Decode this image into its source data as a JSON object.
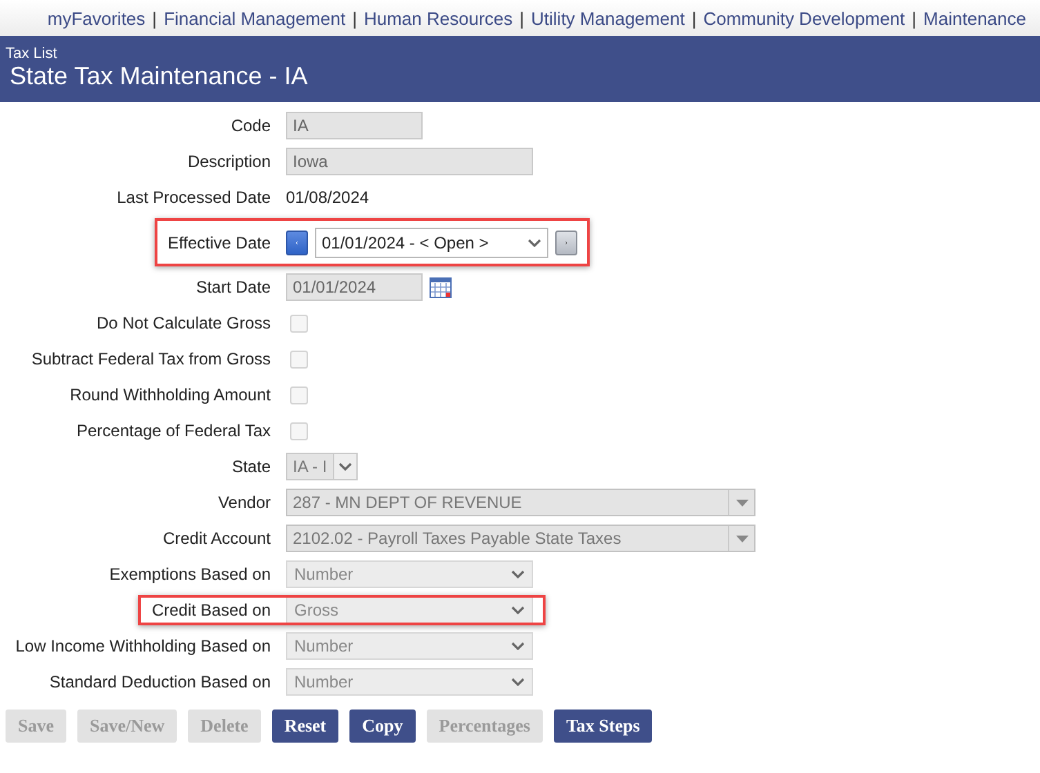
{
  "nav": {
    "separator": "|",
    "items": [
      "myFavorites",
      "Financial Management",
      "Human Resources",
      "Utility Management",
      "Community Development",
      "Maintenance"
    ]
  },
  "header": {
    "breadcrumb": "Tax List",
    "title": "State Tax Maintenance - IA"
  },
  "form": [
    {
      "label": "Code",
      "kind": "short-text",
      "value": "IA",
      "highlighted": false
    },
    {
      "label": "Description",
      "kind": "long-text",
      "value": "Iowa",
      "highlighted": false
    },
    {
      "label": "Last Processed Date",
      "kind": "static",
      "value": "01/08/2024",
      "highlighted": false
    },
    {
      "label": "Effective Date",
      "kind": "period",
      "value": "01/01/2024 - < Open >",
      "highlighted": true
    },
    {
      "label": "Start Date",
      "kind": "date",
      "value": "01/01/2024",
      "highlighted": false
    },
    {
      "label": "Do Not Calculate Gross",
      "kind": "checkbox",
      "checked": false,
      "highlighted": false
    },
    {
      "label": "Subtract Federal Tax from Gross",
      "kind": "checkbox",
      "checked": false,
      "highlighted": false
    },
    {
      "label": "Round Withholding Amount",
      "kind": "checkbox",
      "checked": false,
      "highlighted": false
    },
    {
      "label": "Percentage of Federal Tax",
      "kind": "checkbox",
      "checked": false,
      "highlighted": false
    },
    {
      "label": "State",
      "kind": "mini-select",
      "value": "IA - I",
      "highlighted": false
    },
    {
      "label": "Vendor",
      "kind": "combo",
      "value": "287 - MN DEPT OF REVENUE",
      "highlighted": false
    },
    {
      "label": "Credit Account",
      "kind": "combo",
      "value": "2102.02 - Payroll Taxes Payable State Taxes",
      "highlighted": false
    },
    {
      "label": "Exemptions Based on",
      "kind": "select",
      "value": "Number",
      "highlighted": false
    },
    {
      "label": "Credit Based on",
      "kind": "select",
      "value": "Gross",
      "highlighted": true
    },
    {
      "label": "Low Income Withholding Based on",
      "kind": "select",
      "value": "Number",
      "highlighted": false
    },
    {
      "label": "Standard Deduction Based on",
      "kind": "select",
      "value": "Number",
      "highlighted": false
    }
  ],
  "buttons": [
    {
      "label": "Save",
      "disabled": true
    },
    {
      "label": "Save/New",
      "disabled": true
    },
    {
      "label": "Delete",
      "disabled": true
    },
    {
      "label": "Reset",
      "disabled": false
    },
    {
      "label": "Copy",
      "disabled": false
    },
    {
      "label": "Percentages",
      "disabled": true
    },
    {
      "label": "Tax Steps",
      "disabled": false
    }
  ]
}
